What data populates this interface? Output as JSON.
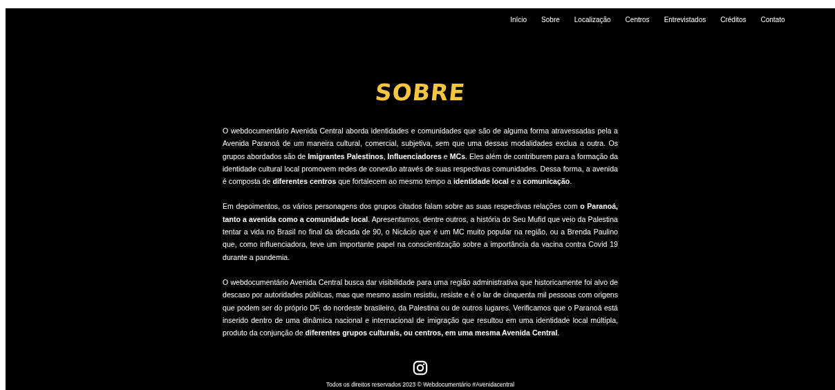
{
  "nav": {
    "items": [
      {
        "label": "Início"
      },
      {
        "label": "Sobre"
      },
      {
        "label": "Localização"
      },
      {
        "label": "Centros"
      },
      {
        "label": "Entrevistados"
      },
      {
        "label": "Créditos"
      },
      {
        "label": "Contato"
      }
    ]
  },
  "title": "SOBRE",
  "paragraphs": [
    "O webdocumentário Avenida Central aborda identidades e comunidades que são de alguma forma atravessadas pela a Avenida Paranoá de um maneira cultural, comercial, subjetiva, sem que uma dessas modalidades exclua a outra. Os grupos abordados são de **Imigrantes Palestinos**, **Influenciadores** e **MCs**. Eles além de contriburem para a formação da identidade cultural local promovem redes de conexão através de suas respectivas comunidades. Dessa forma, a avenida é composta de **diferentes centros** que fortalecem ao mesmo tempo a  **identidade local** e a **comunicação**.",
    "Em depoimentos, os vários personagens dos grupos citados falam sobre as suas respectivas relações com **o Paranoá, tanto a avenida como a comunidade local**. Apresentamos, dentre outros,  a história do Seu Mufid que veio da Palestina tentar a vida no Brasil no final da década de 90, o Nicácio que é um MC muito popular na região, ou a Brenda Paulino que, como influenciadora, teve um importante papel na conscientização sobre a importância da vacina contra Covid 19 durante a pandemia.",
    "O webdocumentário Avenida Central  busca dar visibilidade para uma região administrativa que historicamente foi alvo de descaso por autoridades públicas, mas que mesmo assim resistiu, resiste e é o lar de cinquenta mil pessoas com origens que podem ser do próprio DF, do nordeste brasileiro, da Palestina ou de outros lugares. Verificamos que o Paranoá está inserido dentro de uma dinâmica nacional e internacional de imigração que resultou em uma identidade local múltipla, produto da conjunção de **diferentes grupos culturais, ou centros, em uma mesma Avenida Central**."
  ],
  "footer": {
    "copyright": "Todos os direitos reservados 2023 © Webdocumentário #Avenidacentral"
  }
}
